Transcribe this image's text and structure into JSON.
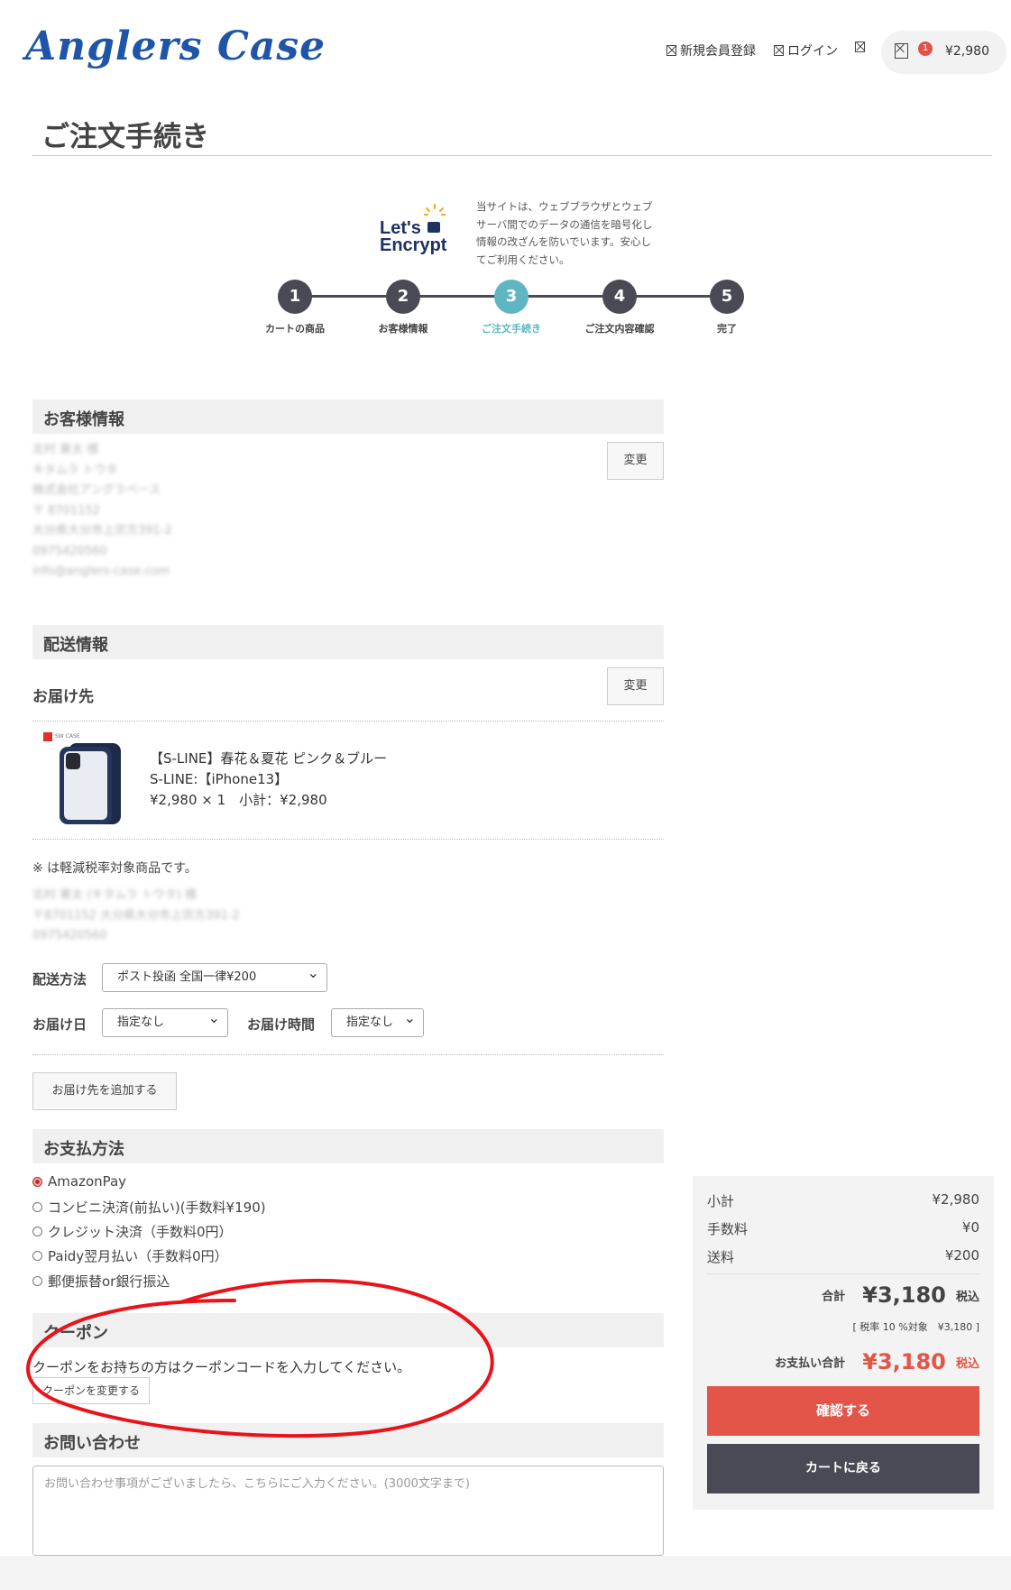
{
  "header": {
    "logo": "Anglers Case",
    "nav": {
      "register": "新規会員登録",
      "login": "ログイン"
    },
    "cart": {
      "count": "1",
      "amount": "¥2,980"
    }
  },
  "page_title": "ご注文手続き",
  "security": {
    "badge_line1": "Let's",
    "badge_line2": "Encrypt",
    "note": "当サイトは、ウェブブラウザとウェブサーバ間でのデータの通信を暗号化し情報の改ざんを防いでいます。安心してご利用ください。"
  },
  "steps": [
    {
      "num": "1",
      "label": "カートの商品"
    },
    {
      "num": "2",
      "label": "お客様情報"
    },
    {
      "num": "3",
      "label": "ご注文手続き",
      "active": true
    },
    {
      "num": "4",
      "label": "ご注文内容確認"
    },
    {
      "num": "5",
      "label": "完了"
    }
  ],
  "customer": {
    "heading": "お客様情報",
    "change": "変更",
    "lines": [
      "北村 東太 様",
      "キタムラ トウタ",
      "株式会社アングラベース",
      "〒 8701152",
      "大分県大分市上宗方391-2",
      "0975420560",
      "info@anglers-case.com"
    ]
  },
  "shipping": {
    "heading": "配送情報",
    "destination_label": "お届け先",
    "change": "変更",
    "product": {
      "name": "【S-LINE】春花＆夏花 ピンク＆ブルー",
      "variant": "S-LINE:【iPhone13】",
      "price_line": "¥2,980 × 1　小計：¥2,980",
      "brand_tag": "SW CASE"
    },
    "tax_note": "※ は軽減税率対象商品です。",
    "address_lines": [
      "北村 東太 (キタムラ トウタ) 様",
      "〒8701152 大分県大分市上宗方391-2",
      "0975420560"
    ],
    "method_label": "配送方法",
    "method_value": "ポスト投函 全国一律¥200",
    "date_label": "お届け日",
    "date_value": "指定なし",
    "time_label": "お届け時間",
    "time_value": "指定なし",
    "add_destination": "お届け先を追加する"
  },
  "payment": {
    "heading": "お支払方法",
    "options": [
      {
        "label": "AmazonPay",
        "selected": true
      },
      {
        "label": "コンビニ決済(前払い)(手数料¥190)"
      },
      {
        "label": "クレジット決済（手数料0円）"
      },
      {
        "label": "Paidy翌月払い（手数料0円）"
      },
      {
        "label": "郵便振替or銀行振込"
      }
    ]
  },
  "coupon": {
    "heading": "クーポン",
    "text": "クーポンをお持ちの方はクーポンコードを入力してください。",
    "button": "クーポンを変更する"
  },
  "inquiry": {
    "heading": "お問い合わせ",
    "placeholder": "お問い合わせ事項がございましたら、こちらにご入力ください。(3000文字まで)"
  },
  "summary": {
    "subtotal_label": "小計",
    "subtotal": "¥2,980",
    "fee_label": "手数料",
    "fee": "¥0",
    "shipping_label": "送料",
    "shipping": "¥200",
    "total_label": "合計",
    "total": "¥3,180",
    "tax_in": "税込",
    "tax_note": "[ 税率 10 %対象　¥3,180 ]",
    "pay_total_label": "お支払い合計",
    "pay_total": "¥3,180",
    "confirm": "確認する",
    "back": "カートに戻る"
  },
  "colors": {
    "brand": "#1f55a8",
    "accent": "#e25548",
    "step_active": "#5fb6c2",
    "dark": "#4a4a55",
    "annotation": "#e8141a"
  }
}
